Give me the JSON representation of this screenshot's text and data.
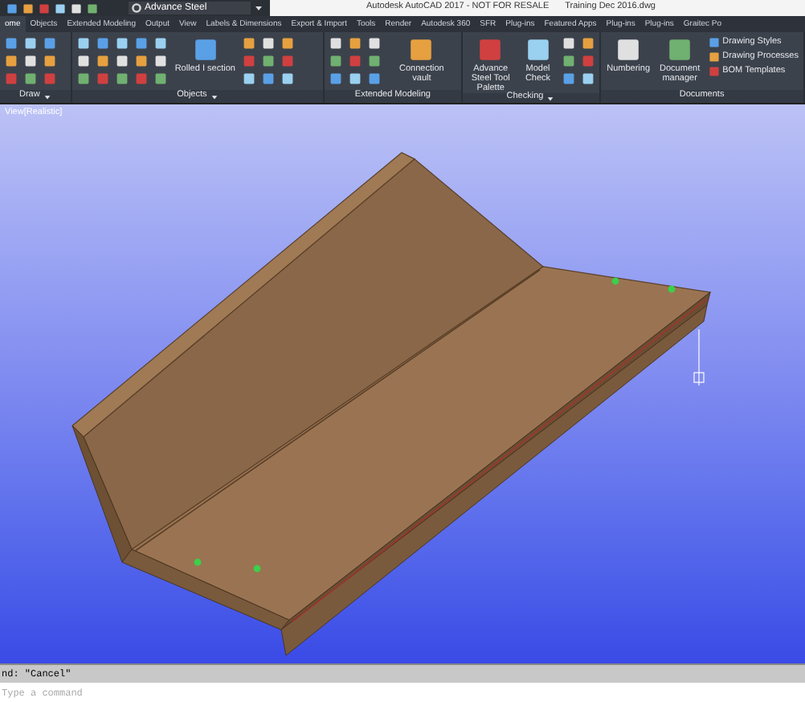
{
  "title_bar": {
    "workspace": "Advance Steel",
    "title": "Autodesk AutoCAD 2017 - NOT FOR RESALE",
    "filename": "Training Dec 2016.dwg"
  },
  "tabs": [
    {
      "label": "ome",
      "selected": true
    },
    {
      "label": "Objects",
      "selected": false
    },
    {
      "label": "Extended Modeling",
      "selected": false
    },
    {
      "label": "Output",
      "selected": false
    },
    {
      "label": "View",
      "selected": false
    },
    {
      "label": "Labels & Dimensions",
      "selected": false
    },
    {
      "label": "Export & Import",
      "selected": false
    },
    {
      "label": "Tools",
      "selected": false
    },
    {
      "label": "Render",
      "selected": false
    },
    {
      "label": "Autodesk 360",
      "selected": false
    },
    {
      "label": "SFR",
      "selected": false
    },
    {
      "label": "Plug-ins",
      "selected": false
    },
    {
      "label": "Featured Apps",
      "selected": false
    },
    {
      "label": "Plug-ins",
      "selected": false
    },
    {
      "label": "Plug-ins",
      "selected": false
    },
    {
      "label": "Graitec Po",
      "selected": false
    }
  ],
  "panels": [
    {
      "title": "Draw",
      "dropdown": true
    },
    {
      "title": "Objects",
      "dropdown": true,
      "tools": [
        {
          "kind": "large",
          "label": "Rolled I section"
        }
      ]
    },
    {
      "title": "Extended Modeling",
      "dropdown": false,
      "tools": [
        {
          "kind": "large",
          "label": "Connection vault"
        }
      ]
    },
    {
      "title": "Checking",
      "dropdown": true,
      "tools": [
        {
          "kind": "large",
          "label": "Advance Steel Tool Palette"
        },
        {
          "kind": "large",
          "label": "Model Check"
        }
      ]
    },
    {
      "title": "Documents",
      "dropdown": false,
      "tools": [
        {
          "kind": "large",
          "label": "Numbering"
        },
        {
          "kind": "large",
          "label": "Document manager"
        },
        {
          "kind": "row",
          "label": "Drawing Styles"
        },
        {
          "kind": "row",
          "label": "Drawing Processes"
        },
        {
          "kind": "row",
          "label": "BOM Templates"
        }
      ]
    }
  ],
  "viewport": {
    "label": "View[Realistic]"
  },
  "command_line": {
    "history": "nd: \"Cancel\"",
    "placeholder": "Type a command"
  }
}
